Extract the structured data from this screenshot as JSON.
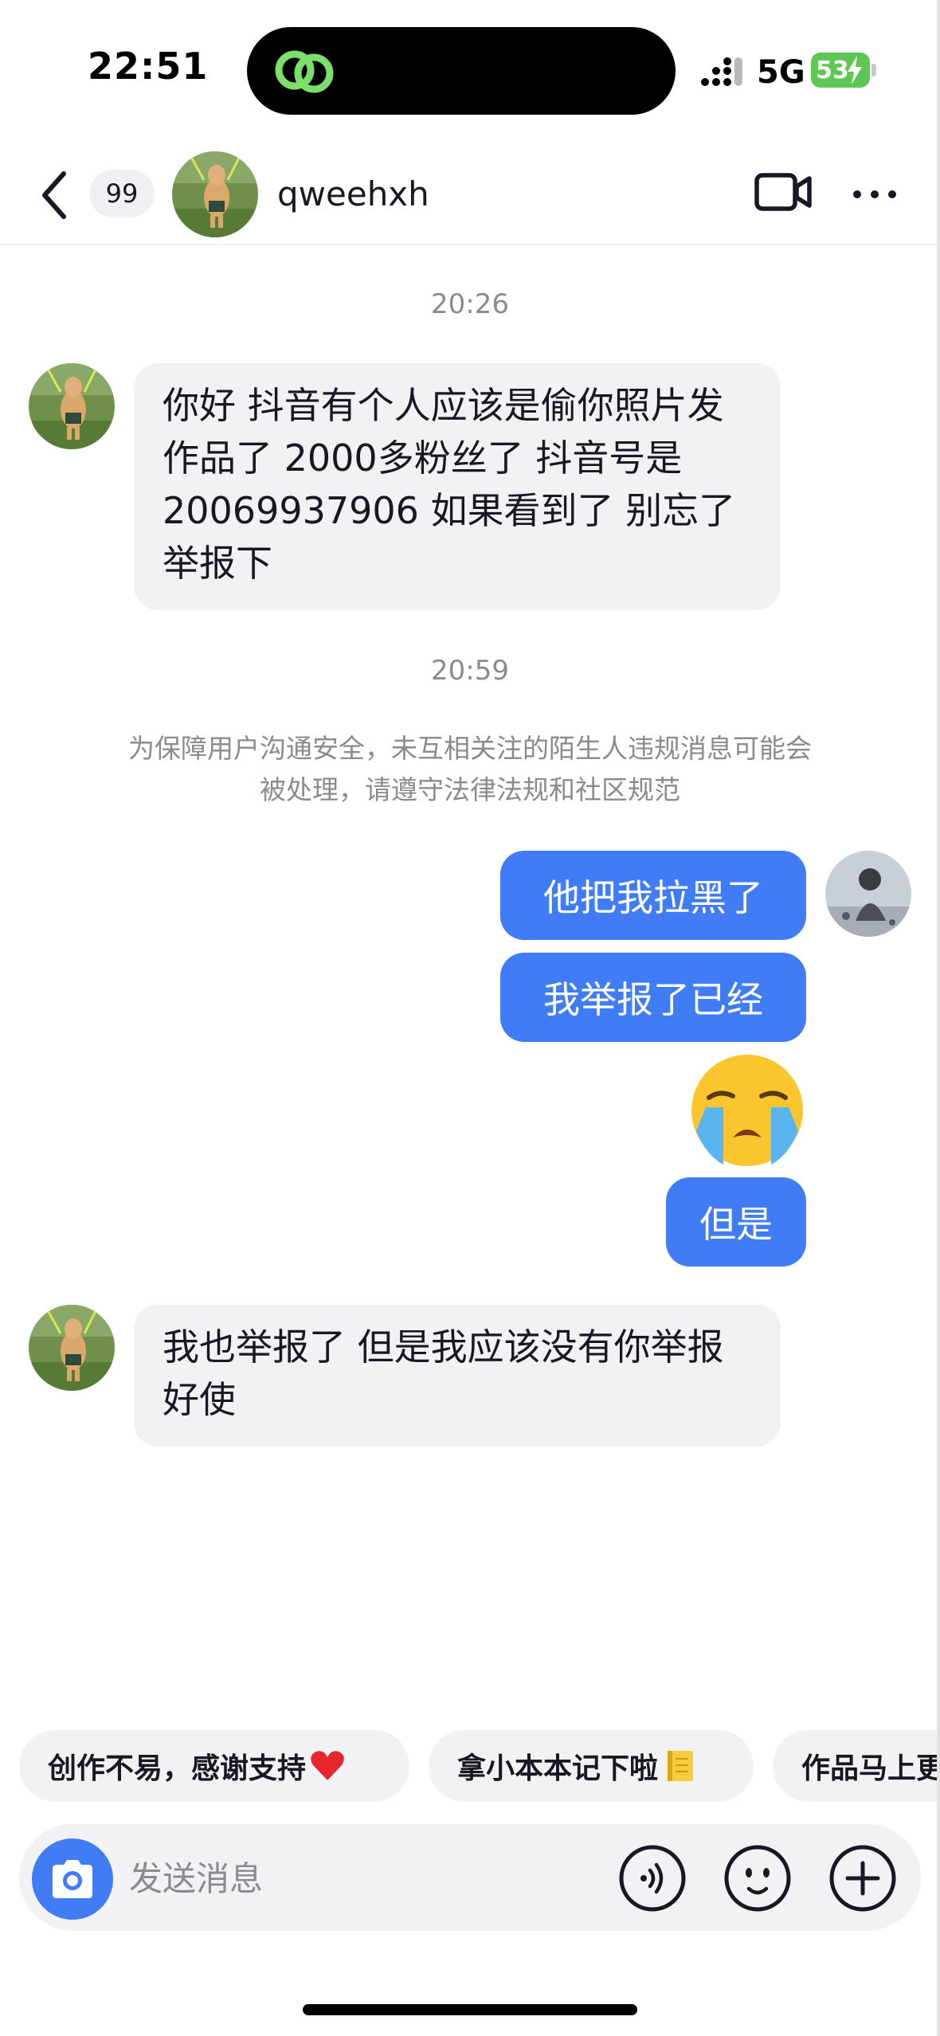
{
  "status_bar": {
    "time": "22:51",
    "network": "5G",
    "battery": "53"
  },
  "header": {
    "unread_count": "99",
    "contact_name": "qweehxh"
  },
  "messages": [
    {
      "type": "timestamp",
      "text": "20:26"
    },
    {
      "type": "incoming",
      "text": "你好 抖音有个人应该是偷你照片发作品了 2000多粉丝了 抖音号是20069937906 如果看到了 别忘了举报下"
    },
    {
      "type": "timestamp",
      "text": "20:59"
    },
    {
      "type": "system",
      "text": "为保障用户沟通安全，未互相关注的陌生人违规消息可能会被处理，请遵守法律法规和社区规范"
    },
    {
      "type": "outgoing",
      "text": "他把我拉黑了"
    },
    {
      "type": "outgoing",
      "text": "我举报了已经"
    },
    {
      "type": "outgoing_emoji",
      "emoji": "loudly-crying-face"
    },
    {
      "type": "outgoing",
      "text": "但是"
    },
    {
      "type": "incoming",
      "text": "我也举报了 但是我应该没有你举报好使"
    }
  ],
  "quick_replies": [
    {
      "label": "创作不易，感谢支持",
      "emoji": "red-heart"
    },
    {
      "label": "拿小本本记下啦",
      "emoji": "notebook"
    },
    {
      "label": "作品马上更"
    }
  ],
  "input": {
    "placeholder": "发送消息"
  },
  "colors": {
    "outgoing_bubble": "#3f7cf5",
    "incoming_bubble": "#f2f2f4",
    "camera_button": "#3f7cf5",
    "battery": "#5ec653",
    "island_icon": "#7be06a"
  }
}
